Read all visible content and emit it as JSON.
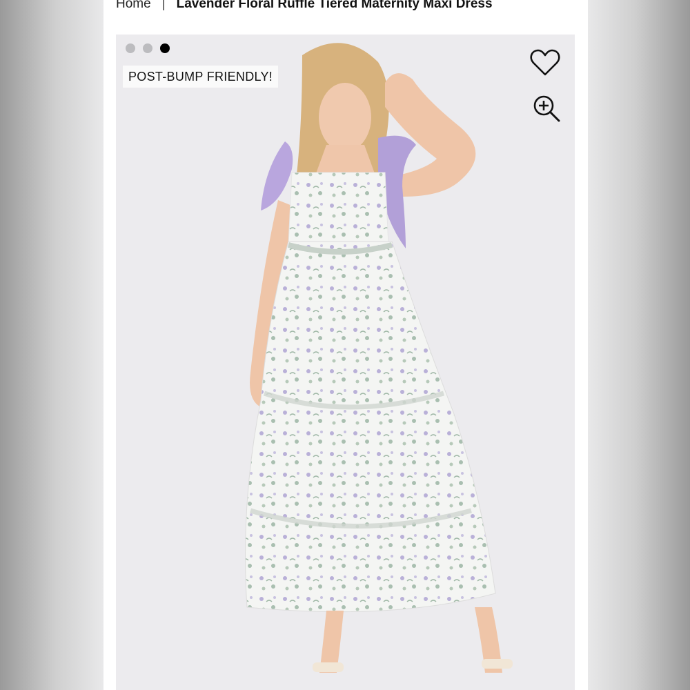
{
  "breadcrumb": {
    "home": "Home",
    "separator": "|",
    "current": "Lavender Floral Ruffle Tiered Maternity Maxi Dress"
  },
  "gallery": {
    "dots": [
      {
        "active": false
      },
      {
        "active": false
      },
      {
        "active": true
      }
    ],
    "badge": "POST-BUMP FRIENDLY!",
    "wishlist_icon": "heart-outline-icon",
    "zoom_icon": "zoom-in-icon"
  },
  "colors": {
    "accent_lavender": "#b9a6de",
    "active_dot": "#000000",
    "inactive_dot": "#bcbcbf",
    "photo_background": "#ecebee"
  }
}
